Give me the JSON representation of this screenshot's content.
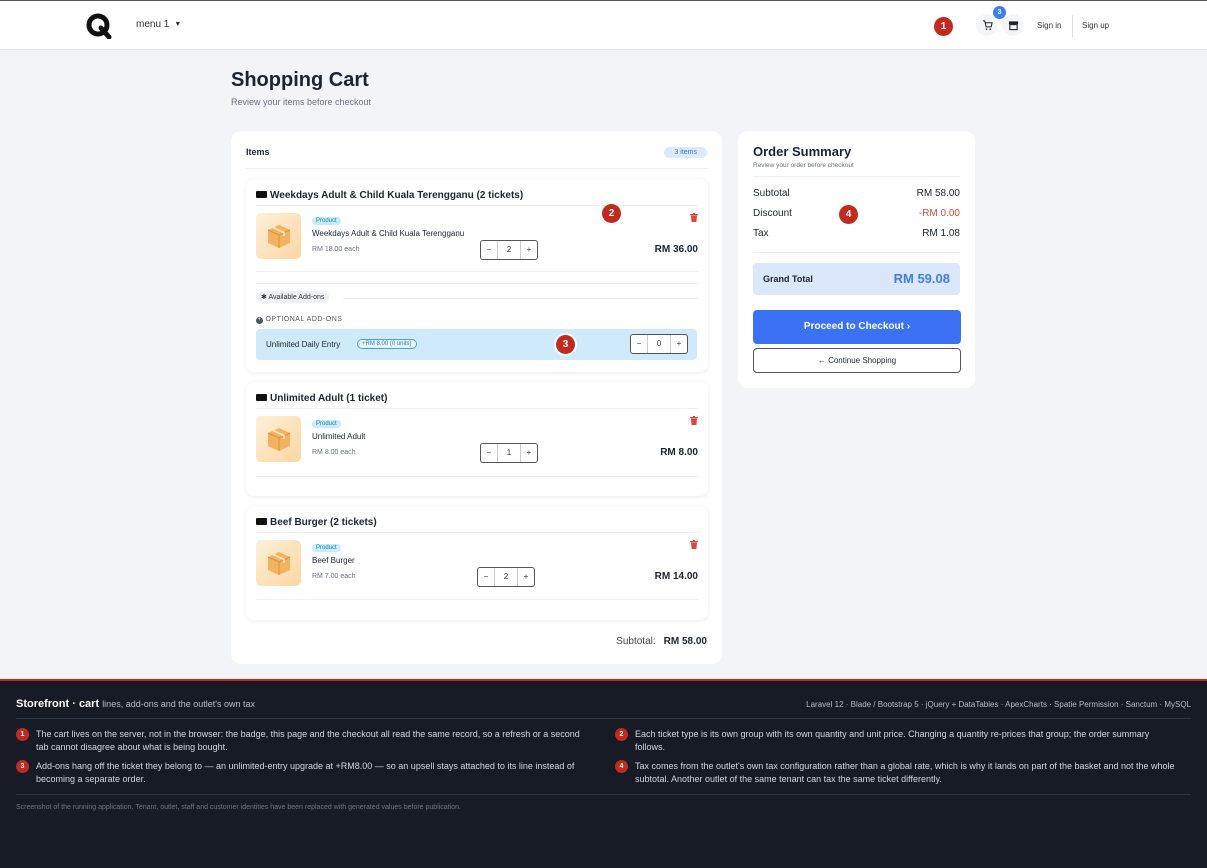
{
  "nav": {
    "menu": "menu 1",
    "cart_count": "3",
    "sign_in": "Sign in",
    "sign_up": "Sign up",
    "callout": "1"
  },
  "page": {
    "title": "Shopping Cart",
    "subtitle": "Review your items before checkout"
  },
  "items": {
    "heading": "Items",
    "count": "3 items",
    "groups": [
      {
        "title": "Weekdays Adult & Child Kuala Terengganu (2 tickets)",
        "badge": "Product",
        "name": "Weekdays Adult & Child Kuala Terengganu",
        "unit": "RM 18.00 each",
        "qty": "2",
        "total": "RM 36.00",
        "callout": "2"
      },
      {
        "title": "Unlimited Adult (1 ticket)",
        "badge": "Product",
        "name": "Unlimited Adult",
        "unit": "RM 8.00 each",
        "qty": "1",
        "total": "RM 8.00"
      },
      {
        "title": "Beef Burger (2 tickets)",
        "badge": "Product",
        "name": "Beef Burger",
        "unit": "RM 7.00 each",
        "qty": "2",
        "total": "RM 14.00"
      }
    ],
    "addons": {
      "tag": "Available Add-ons",
      "optional": "OPTIONAL ADD-ONS",
      "name": "Unlimited Daily Entry",
      "pill": "+RM 8.00 (0 units)",
      "qty": "0",
      "callout": "3"
    },
    "subtotal_label": "Subtotal:",
    "subtotal_value": "RM 58.00"
  },
  "summary": {
    "title": "Order Summary",
    "subtitle": "Review your order before checkout",
    "subtotal_label": "Subtotal",
    "subtotal": "RM 58.00",
    "discount_label": "Discount",
    "discount": "-RM 0.00",
    "tax_label": "Tax",
    "tax": "RM 1.08",
    "grand_label": "Grand Total",
    "grand": "RM 59.08",
    "checkout": "Proceed to Checkout",
    "continue": "Continue Shopping",
    "callout": "4"
  },
  "footer": {
    "title": "Storefront · cart",
    "desc": "lines, add-ons and the outlet's own tax",
    "stack": "Laravel 12 · Blade / Bootstrap 5 · jQuery + DataTables · ApexCharts · Spatie Permission · Sanctum · MySQL",
    "notes": [
      {
        "n": "1",
        "text": "The cart lives on the server, not in the browser: the badge, this page and the checkout all read the same record, so a refresh or a second tab cannot disagree about what is being bought."
      },
      {
        "n": "2",
        "text": "Each ticket type is its own group with its own quantity and unit price. Changing a quantity re-prices that group; the order summary follows."
      },
      {
        "n": "3",
        "text": "Add-ons hang off the ticket they belong to — an unlimited-entry upgrade at +RM8.00 — so an upsell stays attached to its line instead of becoming a separate order."
      },
      {
        "n": "4",
        "text": "Tax comes from the outlet's own tax configuration rather than a global rate, which is why it lands on part of the basket and not the whole subtotal. Another outlet of the same tenant can tax the same ticket differently."
      }
    ],
    "disclaimer": "Screenshot of the running application. Tenant, outlet, staff and customer identities have been replaced with generated values before publication."
  },
  "colors": {
    "accent": "#3b72f5",
    "callout": "#c22a1f",
    "discount": "#e0443a",
    "footer_bg": "#171b25"
  }
}
